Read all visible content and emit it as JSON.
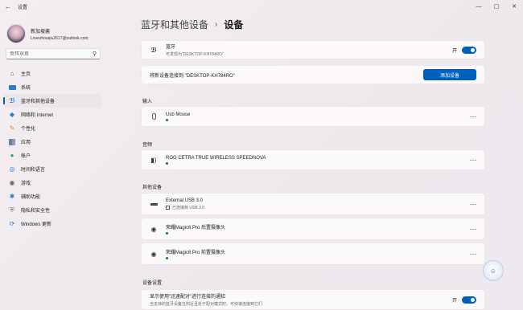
{
  "window": {
    "title": "设置",
    "back_icon": "back-arrow-icon",
    "min_glyph": "—",
    "max_glyph": "▢",
    "close_glyph": "✕"
  },
  "profile": {
    "name": "新加坡酱",
    "email": "Lovezhouqiu2617@outlook.com"
  },
  "search": {
    "placeholder": "查找设置"
  },
  "nav": {
    "items": [
      {
        "label": "主页",
        "icon": "home-icon"
      },
      {
        "label": "系统",
        "icon": "system-icon"
      },
      {
        "label": "蓝牙和其他设备",
        "icon": "bluetooth-icon",
        "active": true
      },
      {
        "label": "网络和 Internet",
        "icon": "network-icon"
      },
      {
        "label": "个性化",
        "icon": "brush-icon"
      },
      {
        "label": "应用",
        "icon": "apps-icon"
      },
      {
        "label": "帐户",
        "icon": "account-icon"
      },
      {
        "label": "时间和语言",
        "icon": "globe-clock-icon"
      },
      {
        "label": "游戏",
        "icon": "gamepad-icon"
      },
      {
        "label": "辅助功能",
        "icon": "accessibility-icon"
      },
      {
        "label": "隐私和安全性",
        "icon": "shield-icon"
      },
      {
        "label": "Windows 更新",
        "icon": "update-icon"
      }
    ]
  },
  "breadcrumb": {
    "parent": "蓝牙和其他设备",
    "separator": "›",
    "current": "设备"
  },
  "bluetooth": {
    "title": "蓝牙",
    "subtitle": "可发现为\"DESKTOP-KH784RO\"",
    "toggle_label": "开"
  },
  "pair": {
    "text": "将新设备连接到 \"DESKTOP-KH784RO\"",
    "button": "添加设备"
  },
  "sections": {
    "input": "输入",
    "audio": "音频",
    "other": "其他设备",
    "settings": "设备设置"
  },
  "devices": {
    "mouse": {
      "name": "Usb Mouse"
    },
    "audio": {
      "name": "ROG CETRA TRUE WIRELESS SPEEDNOVA"
    },
    "usb": {
      "name": "External USB 3.0",
      "status": "已连接到 USB 3.0"
    },
    "cam_rear": {
      "name": "荣耀Magic6 Pro 后置摄像头"
    },
    "cam_front": {
      "name": "荣耀Magic6 Pro 前置摄像头"
    }
  },
  "notify": {
    "title": "显示使用“迅速配对”进行连接的通知",
    "desc": "当支持的蓝牙设备在附近且处于配对模式时，可快速连接到它们",
    "toggle_label": "开"
  },
  "more_glyph": "···",
  "colors": {
    "accent": "#005fb8",
    "connected": "#107c10"
  }
}
